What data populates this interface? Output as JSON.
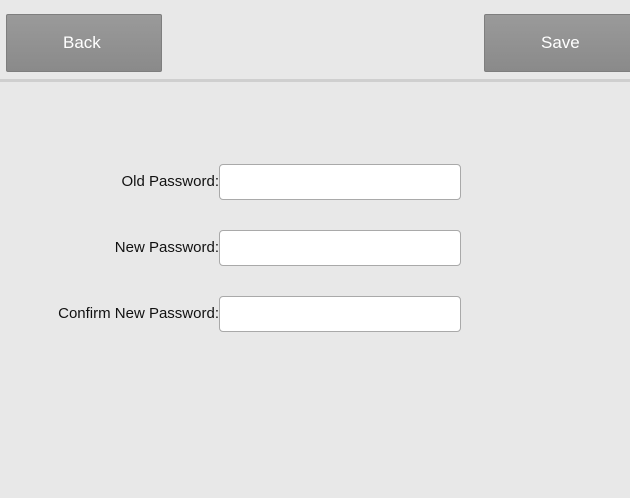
{
  "toolbar": {
    "back_label": "Back",
    "save_label": "Save"
  },
  "form": {
    "old_password": {
      "label": "Old Password:",
      "value": ""
    },
    "new_password": {
      "label": "New Password:",
      "value": ""
    },
    "confirm_password": {
      "label": "Confirm New Password:",
      "value": ""
    }
  },
  "colors": {
    "background": "#e8e8e8",
    "button": "#929292",
    "button_text": "#ffffff",
    "divider": "#cfcfcf"
  }
}
